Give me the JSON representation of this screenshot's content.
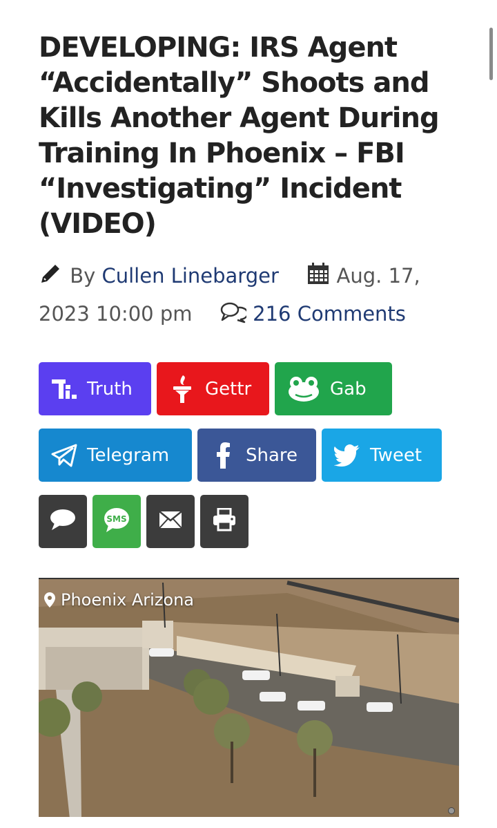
{
  "article": {
    "headline": "DEVELOPING: IRS Agent “Accidentally” Shoots and Kills Another Agent During Training In Phoenix – FBI “Investigating” Incident (VIDEO)",
    "by_prefix": "By",
    "author": "Cullen Linebarger",
    "date": "Aug. 17, 2023 10:00 pm",
    "comments": "216 Comments"
  },
  "share_buttons": [
    {
      "label": "Truth",
      "icon": "truth-social-icon",
      "color": "#5b3ff0"
    },
    {
      "label": "Gettr",
      "icon": "gettr-torch-icon",
      "color": "#e8171c"
    },
    {
      "label": "Gab",
      "icon": "gab-frog-icon",
      "color": "#21a54c"
    },
    {
      "label": "Telegram",
      "icon": "paper-plane-icon",
      "color": "#1688cf"
    },
    {
      "label": "Share",
      "icon": "facebook-icon",
      "color": "#3b5797"
    },
    {
      "label": "Tweet",
      "icon": "twitter-bird-icon",
      "color": "#1aa6e6"
    }
  ],
  "small_share_buttons": [
    {
      "icon": "chat-bubble-icon",
      "color": "#3c3c3c"
    },
    {
      "icon": "sms-icon",
      "icon_text": "SMS",
      "color": "#3fae49"
    },
    {
      "icon": "envelope-icon",
      "color": "#3c3c3c"
    },
    {
      "icon": "printer-icon",
      "color": "#3c3c3c"
    }
  ],
  "video": {
    "location_label": "Phoenix Arizona"
  }
}
